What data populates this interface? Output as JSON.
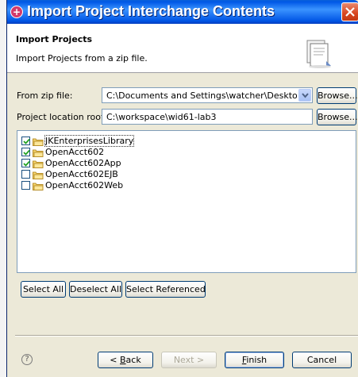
{
  "window": {
    "title": "Import Project Interchange Contents"
  },
  "banner": {
    "title": "Import Projects",
    "description": "Import Projects from a zip file."
  },
  "form": {
    "zip_label": "From zip file:",
    "zip_value": "C:\\Documents and Settings\\watcher\\Desktop\\e",
    "location_label": "Project location root:",
    "location_value": "C:\\workspace\\wid61-lab3",
    "browse_label": "Browse..."
  },
  "projects": [
    {
      "name": "JKEnterprisesLibrary",
      "checked": true
    },
    {
      "name": "OpenAcct602",
      "checked": true
    },
    {
      "name": "OpenAcct602App",
      "checked": true
    },
    {
      "name": "OpenAcct602EJB",
      "checked": false
    },
    {
      "name": "OpenAcct602Web",
      "checked": false
    }
  ],
  "selection_buttons": {
    "select_all": "Select All",
    "deselect_all": "Deselect All",
    "select_referenced": "Select Referenced"
  },
  "footer": {
    "help": "?",
    "back_mnemonic": "B",
    "back_rest": "ack",
    "back_prefix": "< ",
    "next": "Next >",
    "finish_mnemonic": "F",
    "finish_rest": "inish",
    "cancel": "Cancel"
  },
  "colors": {
    "titlebar": "#0055e5",
    "dialog_bg": "#ece9d8",
    "close_button": "#d8451f"
  }
}
